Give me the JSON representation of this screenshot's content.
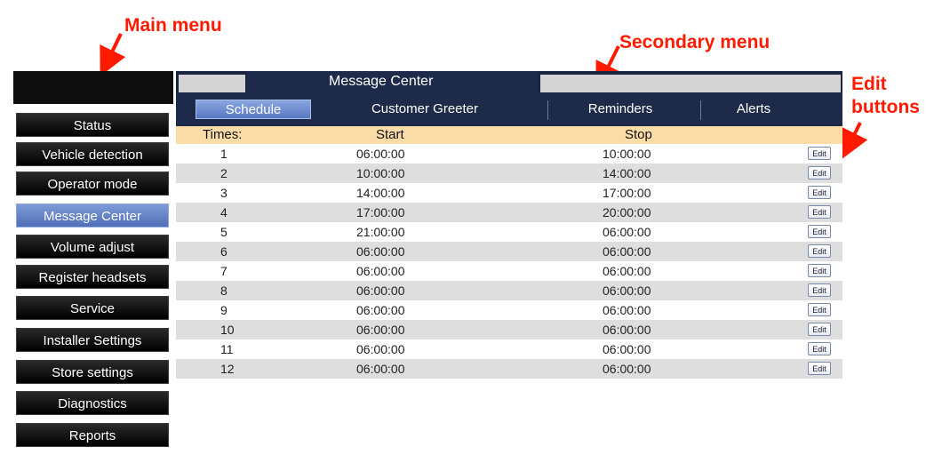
{
  "annotations": {
    "main_menu": "Main menu",
    "secondary_menu": "Secondary menu",
    "edit_buttons_line1": "Edit",
    "edit_buttons_line2": "buttons"
  },
  "sidebar": {
    "items": [
      {
        "label": "Status",
        "active": false
      },
      {
        "label": "Vehicle detection",
        "active": false
      },
      {
        "label": "Operator mode",
        "active": false
      },
      {
        "label": "Message Center",
        "active": true
      },
      {
        "label": "Volume adjust",
        "active": false
      },
      {
        "label": "Register headsets",
        "active": false
      },
      {
        "label": "Service",
        "active": false
      },
      {
        "label": "Installer Settings",
        "active": false
      },
      {
        "label": "Store settings",
        "active": false
      },
      {
        "label": "Diagnostics",
        "active": false
      },
      {
        "label": "Reports",
        "active": false
      }
    ]
  },
  "tab": {
    "title": "Message Center"
  },
  "submenu": {
    "items": [
      {
        "label": "Schedule",
        "active": true
      },
      {
        "label": "Customer Greeter",
        "active": false
      },
      {
        "label": "Reminders",
        "active": false
      },
      {
        "label": "Alerts",
        "active": false
      }
    ]
  },
  "table": {
    "headers": {
      "times": "Times:",
      "start": "Start",
      "stop": "Stop"
    },
    "edit_label": "Edit",
    "rows": [
      {
        "num": "1",
        "start": "06:00:00",
        "stop": "10:00:00"
      },
      {
        "num": "2",
        "start": "10:00:00",
        "stop": "14:00:00"
      },
      {
        "num": "3",
        "start": "14:00:00",
        "stop": "17:00:00"
      },
      {
        "num": "4",
        "start": "17:00:00",
        "stop": "20:00:00"
      },
      {
        "num": "5",
        "start": "21:00:00",
        "stop": "06:00:00"
      },
      {
        "num": "6",
        "start": "06:00:00",
        "stop": "06:00:00"
      },
      {
        "num": "7",
        "start": "06:00:00",
        "stop": "06:00:00"
      },
      {
        "num": "8",
        "start": "06:00:00",
        "stop": "06:00:00"
      },
      {
        "num": "9",
        "start": "06:00:00",
        "stop": "06:00:00"
      },
      {
        "num": "10",
        "start": "06:00:00",
        "stop": "06:00:00"
      },
      {
        "num": "11",
        "start": "06:00:00",
        "stop": "06:00:00"
      },
      {
        "num": "12",
        "start": "06:00:00",
        "stop": "06:00:00"
      }
    ]
  },
  "colors": {
    "annotation": "#ff1a00",
    "nav_dark": "#1e2a4a",
    "active_blue": "#5878c2",
    "header_bg": "#fbdca7"
  }
}
